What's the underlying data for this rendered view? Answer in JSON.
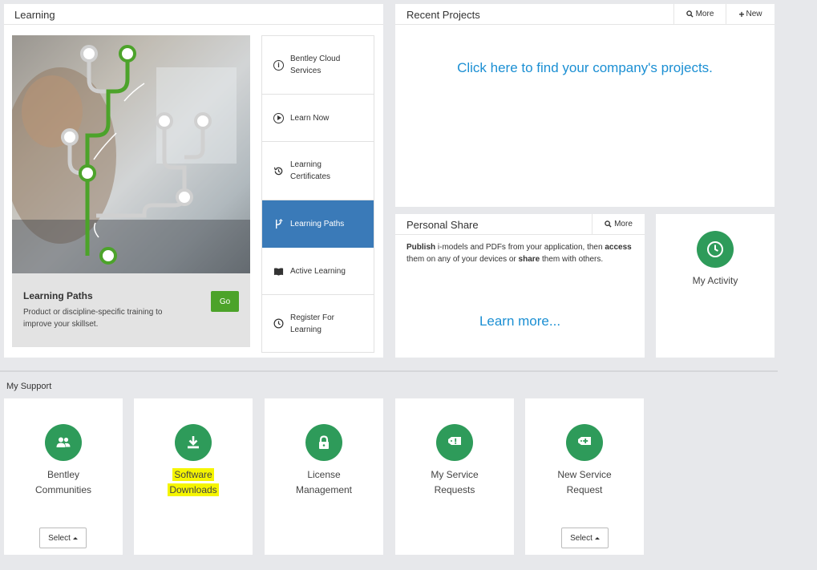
{
  "learning": {
    "title": "Learning",
    "hero": {
      "heading": "Learning Paths",
      "description": "Product or discipline-specific training to improve your skillset.",
      "go_label": "Go"
    },
    "menu": [
      {
        "label": "Bentley Cloud Services",
        "icon": "info-icon",
        "active": false
      },
      {
        "label": "Learn Now",
        "icon": "play-icon",
        "active": false
      },
      {
        "label": "Learning Certificates",
        "icon": "history-icon",
        "active": false
      },
      {
        "label": "Learning Paths",
        "icon": "branch-icon",
        "active": true
      },
      {
        "label": "Active Learning",
        "icon": "book-icon",
        "active": false
      },
      {
        "label": "Register For Learning",
        "icon": "clock-icon",
        "active": false
      }
    ]
  },
  "recent_projects": {
    "title": "Recent Projects",
    "more_label": "More",
    "new_label": "New",
    "link_text": "Click here to find your company's projects."
  },
  "personal_share": {
    "title": "Personal Share",
    "more_label": "More",
    "desc_publish": "Publish",
    "desc_part1": " i-models and PDFs from your application, then ",
    "desc_access": "access",
    "desc_part2": " them on any of your devices or ",
    "desc_share": "share",
    "desc_part3": " them with others.",
    "learn_more": "Learn more..."
  },
  "my_activity": {
    "label": "My Activity",
    "icon": "clock-icon"
  },
  "my_support": {
    "title": "My Support",
    "cards": [
      {
        "line1": "Bentley",
        "line2": "Communities",
        "icon": "users-icon",
        "select_label": "Select"
      },
      {
        "line1": "Software",
        "line2": "Downloads",
        "icon": "download-icon",
        "highlighted": true
      },
      {
        "line1": "License",
        "line2": "Management",
        "icon": "lock-icon"
      },
      {
        "line1": "My Service",
        "line2": "Requests",
        "icon": "ticket-alert-icon"
      },
      {
        "line1": "New Service",
        "line2": "Request",
        "icon": "ticket-add-icon",
        "select_label": "Select"
      }
    ]
  },
  "colors": {
    "accent_green": "#2e9b5a",
    "go_green": "#4ca32a",
    "active_blue": "#3a7ab8",
    "link_blue": "#1b8fd3",
    "highlight_yellow": "#f5f500"
  }
}
